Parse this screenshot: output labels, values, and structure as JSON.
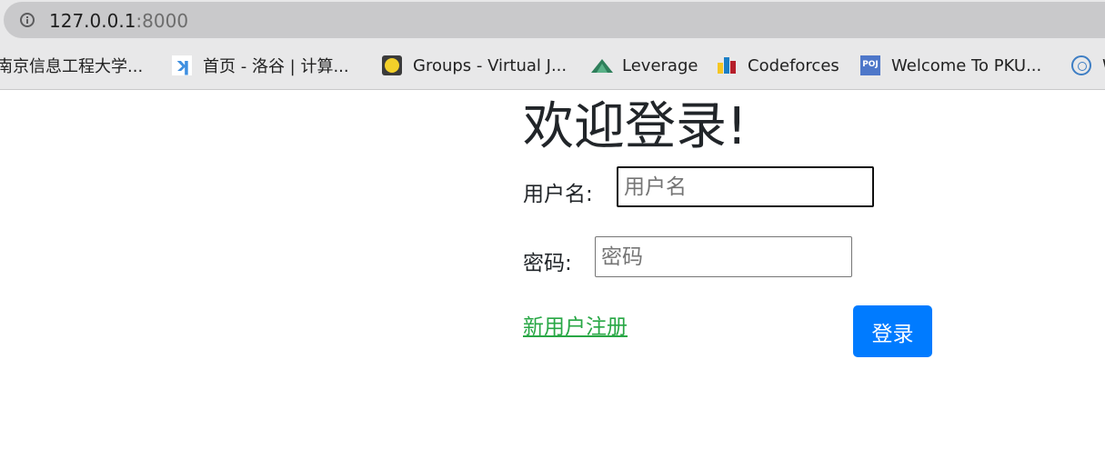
{
  "browser": {
    "url_host": "127.0.0.1",
    "url_port": ":8000",
    "bookmarks": [
      {
        "label": "南京信息工程大学...",
        "icon": "none"
      },
      {
        "label": "首页 - 洛谷 | 计算...",
        "icon": "luogu-icon"
      },
      {
        "label": "Groups - Virtual J...",
        "icon": "vjudge-icon"
      },
      {
        "label": "Leverage",
        "icon": "leverage-icon"
      },
      {
        "label": "Codeforces",
        "icon": "codeforces-icon"
      },
      {
        "label": "Welcome To PKU...",
        "icon": "poj-icon"
      },
      {
        "label": "W",
        "icon": "njupt-icon"
      }
    ],
    "poj_icon_text": "POJ"
  },
  "login": {
    "title": "欢迎登录!",
    "username_label": "用户名:",
    "username_placeholder": "用户名",
    "username_value": "",
    "password_label": "密码:",
    "password_placeholder": "密码",
    "password_value": "",
    "register_link": "新用户注册",
    "submit_label": "登录"
  },
  "colors": {
    "primary_button": "#007bff",
    "register_link": "#28a745",
    "text": "#212529"
  }
}
